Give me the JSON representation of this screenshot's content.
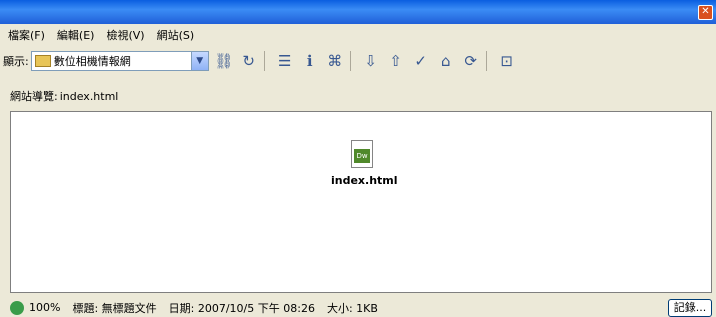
{
  "window": {
    "close_icon": "close-icon"
  },
  "menu": {
    "items": [
      "檔案(F)",
      "編輯(E)",
      "檢視(V)",
      "網站(S)"
    ]
  },
  "toolbar": {
    "display_label": "顯示:",
    "site_selected": "數位相機情報網",
    "buttons": [
      "connect",
      "refresh",
      "list",
      "info",
      "site-map",
      "get",
      "put",
      "check-out",
      "check-in",
      "sync",
      "expand"
    ]
  },
  "site_nav": {
    "label": "網站導覽:",
    "file": "index.html"
  },
  "content": {
    "file_name": "index.html",
    "file_icon_text": "Dw"
  },
  "status": {
    "zoom": "100%",
    "title": "標題: 無標題文件",
    "date": "日期: 2007/10/5 下午 08:26",
    "size": "大小: 1KB",
    "log_button": "記錄..."
  }
}
